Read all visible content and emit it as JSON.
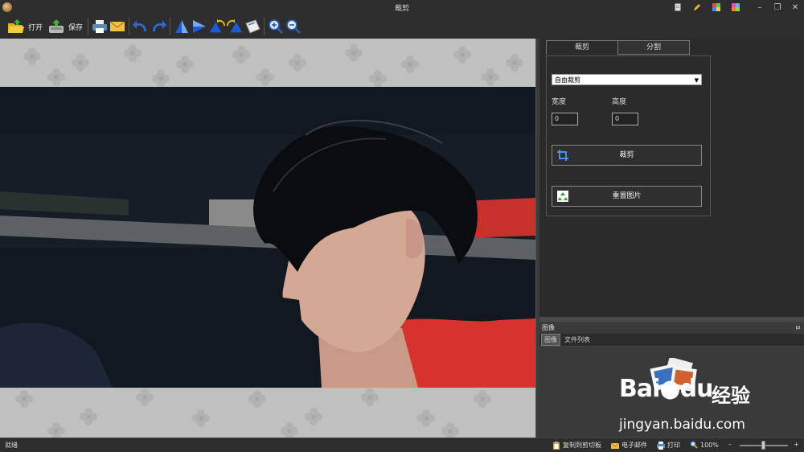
{
  "window": {
    "title": "裁剪"
  },
  "toolbar": {
    "open_label": "打开",
    "save_label": "保存"
  },
  "tabs": [
    {
      "label": "裁剪"
    },
    {
      "label": "分割"
    }
  ],
  "crop": {
    "mode": "自由裁剪",
    "width_label": "宽度",
    "height_label": "高度",
    "width_value": "0",
    "height_value": "0",
    "crop_button": "裁剪",
    "reset_button": "重置图片"
  },
  "image_panel": {
    "title": "图像",
    "pin": "ㅂ",
    "tabs": [
      "图像",
      "文件列表"
    ]
  },
  "status": {
    "text": "就绪",
    "copy": "复制到剪切板",
    "email": "电子邮件",
    "print": "打印",
    "zoom": "100%",
    "minus": "–",
    "plus": "+"
  },
  "watermark": {
    "brand_a": "Bai",
    "brand_b": "du",
    "brand_cn": "经验",
    "url": "jingyan.baidu.com"
  },
  "colors": {
    "accent": "#1e5bd8",
    "background": "#2b2b2b",
    "canvas": "#c0c0c0",
    "shirt": "#d8322e"
  }
}
